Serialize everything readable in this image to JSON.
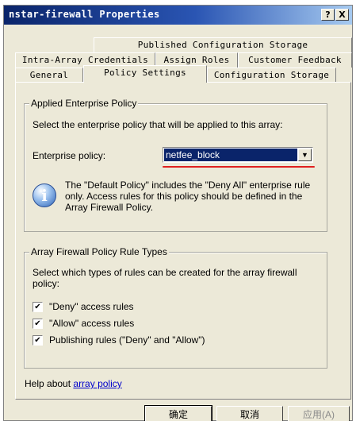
{
  "window": {
    "title": "nstar-firewall Properties",
    "help_glyph": "?",
    "close_glyph": "X"
  },
  "tabs": {
    "row1": [
      "Published Configuration Storage"
    ],
    "row2": [
      "Intra-Array Credentials",
      "Assign Roles",
      "Customer Feedback"
    ],
    "row3": [
      "General",
      "Policy Settings",
      "Configuration Storage"
    ],
    "active": "Policy Settings"
  },
  "enterprise_group": {
    "legend": "Applied Enterprise Policy",
    "description": "Select the enterprise policy that will be applied to this array:",
    "policy_label": "Enterprise policy:",
    "policy_value": "netfee_block",
    "info_text": "The \"Default Policy\" includes the \"Deny All\" enterprise rule only. Access rules for this policy should be defined in the Array Firewall Policy.",
    "info_glyph": "i"
  },
  "rule_types_group": {
    "legend": "Array Firewall Policy Rule Types",
    "description": "Select which types of rules can be created for the array firewall policy:",
    "options": [
      {
        "label": "\"Deny\" access rules",
        "checked": true
      },
      {
        "label": "\"Allow\" access rules",
        "checked": true
      },
      {
        "label": "Publishing rules (\"Deny\" and \"Allow\")",
        "checked": true
      }
    ],
    "check_glyph": "✔"
  },
  "help": {
    "prefix": "Help about",
    "link_text": "array policy"
  },
  "buttons": {
    "ok": "确定",
    "cancel": "取消",
    "apply": "应用(A)"
  },
  "colors": {
    "title_bar": "#0a246a",
    "selection": "#0a246a",
    "annotation_underline": "#e02020",
    "link": "#0000cc"
  }
}
